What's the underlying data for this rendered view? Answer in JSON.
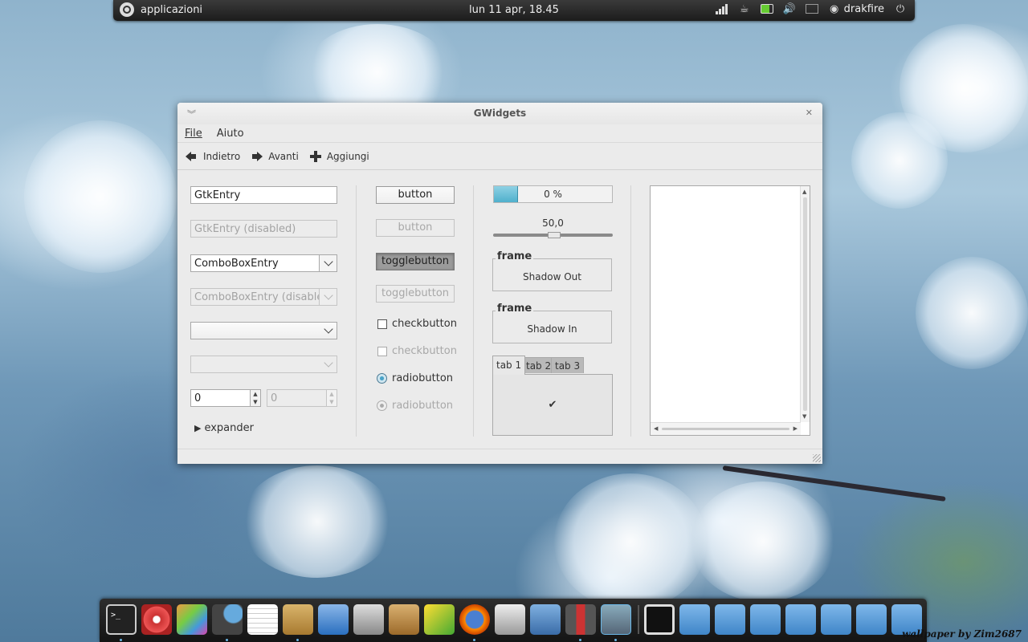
{
  "top_panel": {
    "apps_label": "applicazioni",
    "clock": "lun 11 apr, 18.45",
    "username": "drakfire",
    "tray_icons": [
      "signal-icon",
      "coffee-icon",
      "battery-icon",
      "volume-icon",
      "mail-icon",
      "user-icon",
      "power-icon"
    ]
  },
  "window": {
    "title": "GWidgets",
    "menu": {
      "file": "File",
      "help": "Aiuto"
    },
    "toolbar": {
      "back": "Indietro",
      "forward": "Avanti",
      "add": "Aggiungi"
    },
    "col1": {
      "entry_value": "GtkEntry",
      "entry_disabled_value": "GtkEntry (disabled)",
      "combo_entry_value": "ComboBoxEntry",
      "combo_entry_disabled_value": "ComboBoxEntry (disabled)",
      "spin_value": "0",
      "spin_disabled_value": "0",
      "expander_label": "expander"
    },
    "col2": {
      "button_label": "button",
      "button_disabled_label": "button",
      "toggle_label": "togglebutton",
      "toggle_disabled_label": "togglebutton",
      "check_label": "checkbutton",
      "check_disabled_label": "checkbutton",
      "radio_label": "radiobutton",
      "radio_disabled_label": "radiobutton"
    },
    "col3": {
      "progress_text": "0 %",
      "progress_fill_fraction": 0.2,
      "scale_value": "50,0",
      "scale_fraction": 0.5,
      "frame1_label": "frame",
      "frame1_body": "Shadow Out",
      "frame2_label": "frame",
      "frame2_body": "Shadow In",
      "tabs": [
        "tab 1",
        "tab 2",
        "tab 3"
      ],
      "tab_content": "✔"
    }
  },
  "dock": {
    "watermark": "wallpaper by Zim2687"
  },
  "colors": {
    "accent": "#4fb0cc",
    "panel_bg": "#1c1c1c",
    "window_bg": "#ebebeb"
  }
}
